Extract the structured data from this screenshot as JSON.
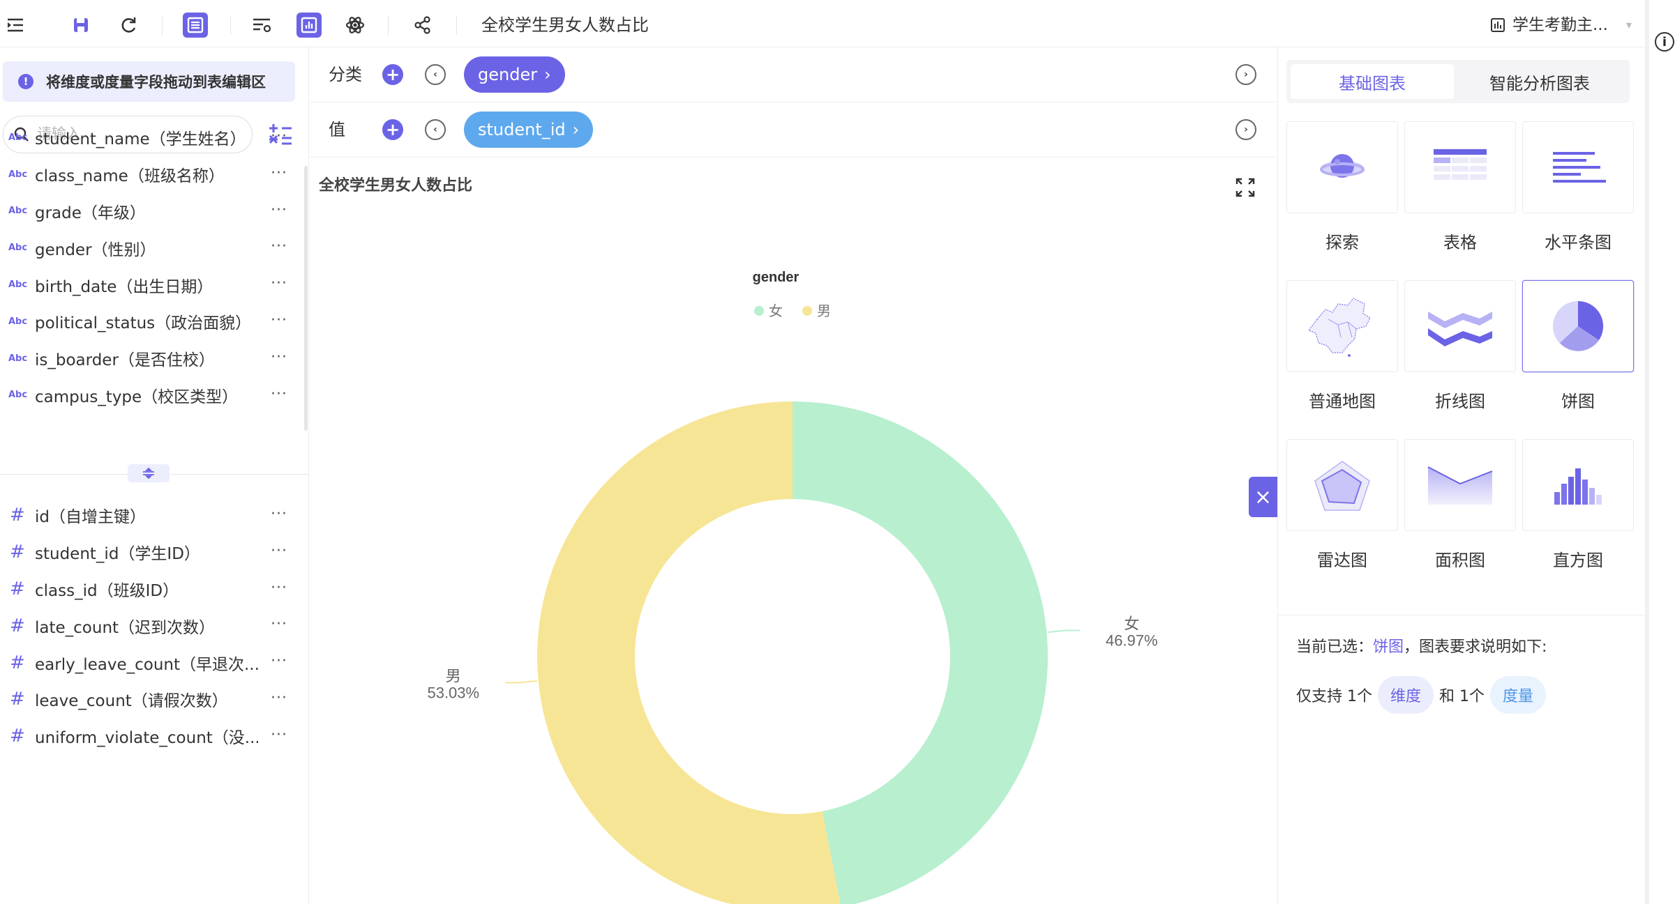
{
  "toolbar": {
    "title": "全校学生男女人数占比",
    "dataset_label": "学生考勤主..."
  },
  "left_panel": {
    "hint": "将维度或度量字段拖动到表编辑区",
    "search_placeholder": "请输入",
    "dimension_type_label": "Abc",
    "measure_type_label": "#",
    "more_label": "···",
    "dimensions": [
      {
        "label": "student_name（学生姓名）"
      },
      {
        "label": "class_name（班级名称）"
      },
      {
        "label": "grade（年级）"
      },
      {
        "label": "gender（性别）"
      },
      {
        "label": "birth_date（出生日期）"
      },
      {
        "label": "political_status（政治面貌）"
      },
      {
        "label": "is_boarder（是否住校）"
      },
      {
        "label": "campus_type（校区类型）"
      }
    ],
    "measures": [
      {
        "label": "id（自增主键）"
      },
      {
        "label": "student_id（学生ID）"
      },
      {
        "label": "class_id（班级ID）"
      },
      {
        "label": "late_count（迟到次数）"
      },
      {
        "label": "early_leave_count（早退次..."
      },
      {
        "label": "leave_count（请假次数）"
      },
      {
        "label": "uniform_violate_count（没..."
      }
    ]
  },
  "editor": {
    "category_label": "分类",
    "value_label": "值",
    "category_field": "gender",
    "value_field": "student_id",
    "chart_title": "全校学生男女人数占比"
  },
  "chart_data": {
    "type": "pie",
    "variant": "donut",
    "title": "",
    "legend_title": "gender",
    "legend_placement": "top-center",
    "slices": [
      {
        "name": "女",
        "percent": 46.97,
        "percent_label": "46.97%",
        "color": "#b7efcf"
      },
      {
        "name": "男",
        "percent": 53.03,
        "percent_label": "53.03%",
        "color": "#f7e596"
      }
    ]
  },
  "right_panel": {
    "tabs": [
      {
        "label": "基础图表",
        "active": true
      },
      {
        "label": "智能分析图表",
        "active": false
      }
    ],
    "chart_types": [
      {
        "label": "探索",
        "icon": "explore-planet-icon"
      },
      {
        "label": "表格",
        "icon": "table-chart-icon"
      },
      {
        "label": "水平条图",
        "icon": "horizontal-bar-chart-icon"
      },
      {
        "label": "普通地图",
        "icon": "china-map-icon"
      },
      {
        "label": "折线图",
        "icon": "line-chart-icon"
      },
      {
        "label": "饼图",
        "icon": "pie-chart-icon",
        "selected": true
      },
      {
        "label": "雷达图",
        "icon": "radar-chart-icon"
      },
      {
        "label": "面积图",
        "icon": "area-chart-icon"
      },
      {
        "label": "直方图",
        "icon": "histogram-chart-icon"
      }
    ],
    "requirement_prefix": "当前已选：",
    "selected_chart_name": "饼图",
    "requirement_suffix": "，图表要求说明如下:",
    "support_prefix": "仅支持 1个",
    "dimension_tag": "维度",
    "and_text": "和 1个",
    "measure_tag": "度量"
  },
  "colors": {
    "accent": "#6b63e5",
    "measure_pill": "#5ea8ee",
    "female_slice": "#b7efcf",
    "male_slice": "#f7e596"
  }
}
